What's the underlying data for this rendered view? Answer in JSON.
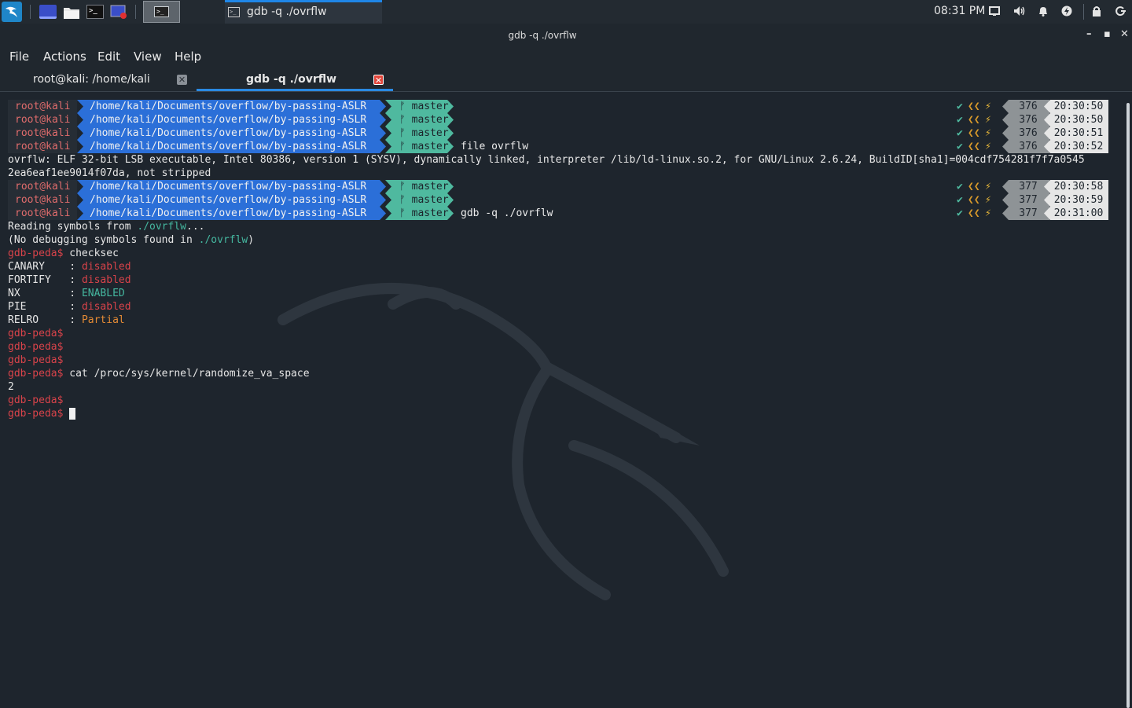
{
  "taskbar": {
    "clock": "08:31 PM",
    "window_task_label": "gdb -q ./ovrflw"
  },
  "window": {
    "title": "gdb -q ./ovrflw"
  },
  "menu": [
    "File",
    "Actions",
    "Edit",
    "View",
    "Help"
  ],
  "tabs": [
    {
      "label": "root@kali: /home/kali",
      "active": false
    },
    {
      "label": "gdb -q ./ovrflw",
      "active": true
    }
  ],
  "prompt": {
    "user": "root@kali",
    "path": "/home/kali/Documents/overflow/by-passing-ASLR",
    "branch": "ᚠ master"
  },
  "prompt_lines": [
    {
      "cmd": "",
      "num": "376",
      "time": "20:30:50"
    },
    {
      "cmd": "",
      "num": "376",
      "time": "20:30:50"
    },
    {
      "cmd": "",
      "num": "376",
      "time": "20:30:51"
    },
    {
      "cmd": "file ovrflw",
      "num": "376",
      "time": "20:30:52"
    },
    {
      "cmd": "",
      "num": "377",
      "time": "20:30:58"
    },
    {
      "cmd": "",
      "num": "377",
      "time": "20:30:59"
    },
    {
      "cmd": "gdb -q ./ovrflw",
      "num": "377",
      "time": "20:31:00"
    }
  ],
  "output": {
    "file_line1": "ovrflw: ELF 32-bit LSB executable, Intel 80386, version 1 (SYSV), dynamically linked, interpreter /lib/ld-linux.so.2, for GNU/Linux 2.6.24, BuildID[sha1]=004cdf754281f7f7a0545",
    "file_line2": "2ea6eaf1ee9014f07da, not stripped",
    "reading_prefix": "Reading symbols from ",
    "reading_path": "./ovrflw",
    "reading_suffix": "...",
    "nodebug_prefix": "(No debugging symbols found in ",
    "nodebug_path": "./ovrflw",
    "nodebug_suffix": ")",
    "gdb_prompt": "gdb-peda$",
    "checksec_cmd": "checksec",
    "checksec": [
      {
        "name": "CANARY    ",
        "value": "disabled"
      },
      {
        "name": "FORTIFY   ",
        "value": "disabled"
      },
      {
        "name": "NX        ",
        "value": "ENABLED"
      },
      {
        "name": "PIE       ",
        "value": "disabled"
      },
      {
        "name": "RELRO     ",
        "value": "Partial"
      }
    ],
    "colon": ": ",
    "cat_cmd": "cat /proc/sys/kernel/randomize_va_space",
    "cat_result": "2"
  },
  "colors": {
    "path_bg": "#2b6fd8",
    "git_bg": "#4fb99f",
    "prompt_red": "#d9434a",
    "enabled_green": "#45b8a0",
    "partial_orange": "#e38a35"
  }
}
